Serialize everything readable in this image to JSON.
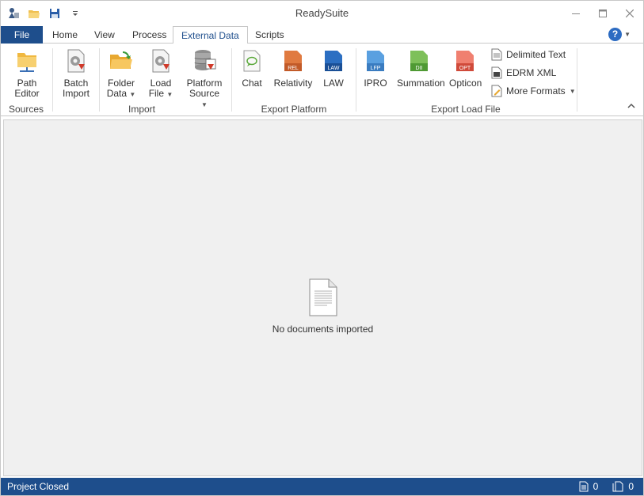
{
  "app": {
    "title": "ReadySuite"
  },
  "tabs": [
    "File",
    "Home",
    "View",
    "Process",
    "External Data",
    "Scripts"
  ],
  "active_tab": "External Data",
  "ribbon": {
    "sources": {
      "label": "Sources",
      "path_editor": [
        "Path",
        "Editor"
      ]
    },
    "import": {
      "label": "Import",
      "batch_import": [
        "Batch",
        "Import"
      ],
      "folder_data": [
        "Folder",
        "Data"
      ],
      "load_file": [
        "Load",
        "File"
      ],
      "platform_source": [
        "Platform",
        "Source"
      ]
    },
    "export_platform": {
      "label": "Export Platform",
      "chat": "Chat",
      "relativity": "Relativity",
      "law": "LAW",
      "rel_badge": "REL",
      "law_badge": "LAW"
    },
    "export_load_file": {
      "label": "Export Load File",
      "ipro": "IPRO",
      "summation": "Summation",
      "opticon": "Opticon",
      "lfp_badge": "LFP",
      "dii_badge": "DII",
      "opt_badge": "OPT",
      "delimited_text": "Delimited Text",
      "edrm_xml": "EDRM XML",
      "more_formats": "More Formats"
    }
  },
  "content": {
    "empty_message": "No documents imported"
  },
  "status": {
    "text": "Project Closed",
    "docs_count": "0",
    "pages_count": "0"
  },
  "colors": {
    "accent": "#1e4e8c",
    "help": "#2c6bc2"
  }
}
